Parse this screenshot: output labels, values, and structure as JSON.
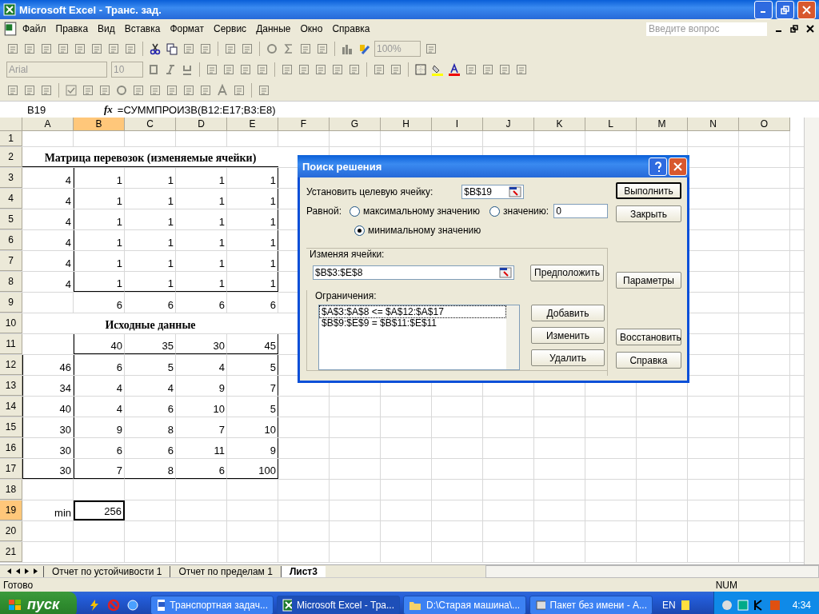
{
  "window": {
    "title": "Microsoft Excel - Транс. зад."
  },
  "menu": [
    "Файл",
    "Правка",
    "Вид",
    "Вставка",
    "Формат",
    "Сервис",
    "Данные",
    "Окно",
    "Справка"
  ],
  "help_search": {
    "placeholder": "Введите вопрос"
  },
  "toolbar": {
    "zoom": "100%",
    "font": "Arial",
    "font_size": "10"
  },
  "formula_bar": {
    "name_box": "B19",
    "fx_label": "fx",
    "formula": "=СУММПРОИЗВ(B12:E17;B3:E8)"
  },
  "columns": [
    {
      "label": "A",
      "selected": false
    },
    {
      "label": "B",
      "selected": true
    },
    {
      "label": "C",
      "selected": false
    },
    {
      "label": "D",
      "selected": false
    },
    {
      "label": "E",
      "selected": false
    },
    {
      "label": "F",
      "selected": false
    },
    {
      "label": "G",
      "selected": false
    },
    {
      "label": "H",
      "selected": false
    },
    {
      "label": "I",
      "selected": false
    },
    {
      "label": "J",
      "selected": false
    },
    {
      "label": "K",
      "selected": false
    },
    {
      "label": "L",
      "selected": false
    },
    {
      "label": "M",
      "selected": false
    },
    {
      "label": "N",
      "selected": false
    },
    {
      "label": "O",
      "selected": false
    }
  ],
  "rows": [
    {
      "number": "1",
      "selected": false,
      "kind": "plain",
      "cells": []
    },
    {
      "number": "2",
      "selected": false,
      "kind": "title",
      "text": "Матрица перевозок (изменяемые ячейки)"
    },
    {
      "number": "3",
      "selected": false,
      "kind": "matrix",
      "cells": [
        "4",
        "1",
        "1",
        "1",
        "1"
      ]
    },
    {
      "number": "4",
      "selected": false,
      "kind": "matrix",
      "cells": [
        "4",
        "1",
        "1",
        "1",
        "1"
      ]
    },
    {
      "number": "5",
      "selected": false,
      "kind": "matrix",
      "cells": [
        "4",
        "1",
        "1",
        "1",
        "1"
      ]
    },
    {
      "number": "6",
      "selected": false,
      "kind": "matrix",
      "cells": [
        "4",
        "1",
        "1",
        "1",
        "1"
      ]
    },
    {
      "number": "7",
      "selected": false,
      "kind": "matrix",
      "cells": [
        "4",
        "1",
        "1",
        "1",
        "1"
      ]
    },
    {
      "number": "8",
      "selected": false,
      "kind": "matrix-end",
      "cells": [
        "4",
        "1",
        "1",
        "1",
        "1"
      ]
    },
    {
      "number": "9",
      "selected": false,
      "kind": "plain",
      "cells": [
        null,
        "6",
        "6",
        "6",
        "6"
      ]
    },
    {
      "number": "10",
      "selected": false,
      "kind": "title",
      "text": "Исходные данные"
    },
    {
      "number": "11",
      "selected": false,
      "kind": "data-head",
      "cells": [
        null,
        "40",
        "35",
        "30",
        "45"
      ]
    },
    {
      "number": "12",
      "selected": false,
      "kind": "data",
      "cells": [
        "46",
        "6",
        "5",
        "4",
        "5"
      ]
    },
    {
      "number": "13",
      "selected": false,
      "kind": "data",
      "cells": [
        "34",
        "4",
        "4",
        "9",
        "7"
      ]
    },
    {
      "number": "14",
      "selected": false,
      "kind": "data",
      "cells": [
        "40",
        "4",
        "6",
        "10",
        "5"
      ]
    },
    {
      "number": "15",
      "selected": false,
      "kind": "data",
      "cells": [
        "30",
        "9",
        "8",
        "7",
        "10"
      ]
    },
    {
      "number": "16",
      "selected": false,
      "kind": "data",
      "cells": [
        "30",
        "6",
        "6",
        "11",
        "9"
      ]
    },
    {
      "number": "17",
      "selected": false,
      "kind": "data-end",
      "cells": [
        "30",
        "7",
        "8",
        "6",
        "100"
      ]
    },
    {
      "number": "18",
      "selected": false,
      "kind": "plain",
      "cells": []
    },
    {
      "number": "19",
      "selected": true,
      "kind": "plain",
      "cells": [
        "min",
        "256"
      ]
    },
    {
      "number": "20",
      "selected": false,
      "kind": "plain",
      "cells": []
    },
    {
      "number": "21",
      "selected": false,
      "kind": "plain",
      "cells": []
    }
  ],
  "sheet_tabs": [
    {
      "label": "Отчет по устойчивости 1",
      "selected": false
    },
    {
      "label": "Отчет по пределам 1",
      "selected": false
    },
    {
      "label": "Лист3",
      "selected": true
    }
  ],
  "status_bar": {
    "status": "Готово",
    "num": "NUM"
  },
  "dialog": {
    "title": "Поиск решения",
    "target_label": "Установить целевую ячейку:",
    "target_value": "$B$19",
    "equal_label": "Равной:",
    "options": [
      {
        "label": "максимальному значению",
        "selected": false
      },
      {
        "label": "значению:",
        "selected": false
      },
      {
        "label": "минимальному значению",
        "selected": true
      }
    ],
    "value_field": "0",
    "changing_label": "Изменяя ячейки:",
    "changing_value": "$B$3:$E$8",
    "guess_button": "Предположить",
    "constraints_label": "Ограничения:",
    "constraints": [
      {
        "text": "$A$3:$A$8 <= $A$12:$A$17",
        "selected": true
      },
      {
        "text": "$B$9:$E$9 = $B$11:$E$11",
        "selected": false
      }
    ],
    "constraint_buttons": [
      "Добавить",
      "Изменить",
      "Удалить"
    ],
    "side_buttons": [
      "Выполнить",
      "Закрыть",
      "Параметры",
      "Восстановить",
      "Справка"
    ]
  },
  "taskbar": {
    "start": "пуск",
    "tasks": [
      {
        "label": "Транспортная задач...",
        "kind": "word",
        "selected": false
      },
      {
        "label": "Microsoft Excel - Тра...",
        "kind": "excel",
        "selected": true
      },
      {
        "label": "D:\\Старая машина\\...",
        "kind": "folder",
        "selected": false
      },
      {
        "label": "Пакет без имени - А...",
        "kind": "package",
        "selected": false
      }
    ],
    "language": "EN",
    "clock": "4:34"
  }
}
